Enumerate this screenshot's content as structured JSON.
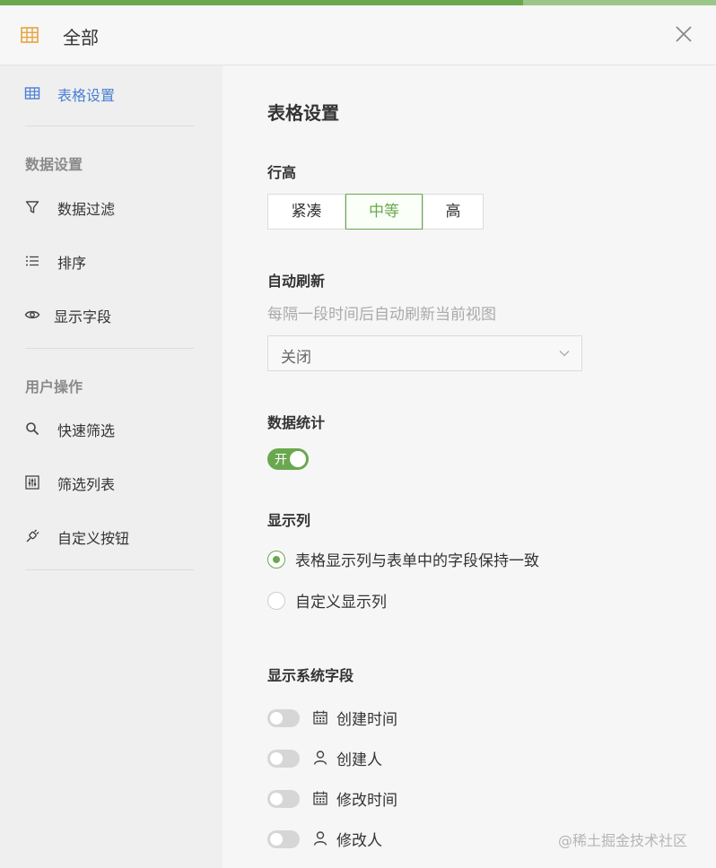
{
  "header": {
    "title": "全部",
    "icon": "table-icon",
    "close_icon": "close-icon"
  },
  "sidebar": {
    "table_settings": "表格设置",
    "group_data": "数据设置",
    "data_filter": "数据过滤",
    "sort": "排序",
    "show_fields": "显示字段",
    "group_user": "用户操作",
    "quick_filter": "快速筛选",
    "filter_list": "筛选列表",
    "custom_button": "自定义按钮"
  },
  "main": {
    "title": "表格设置",
    "row_height": {
      "label": "行高",
      "options": [
        "紧凑",
        "中等",
        "高"
      ],
      "selected": "中等"
    },
    "auto_refresh": {
      "label": "自动刷新",
      "desc": "每隔一段时间后自动刷新当前视图",
      "value": "关闭"
    },
    "data_stats": {
      "label": "数据统计",
      "toggle_text": "开"
    },
    "show_columns": {
      "label": "显示列",
      "options": [
        "表格显示列与表单中的字段保持一致",
        "自定义显示列"
      ],
      "selected": "表格显示列与表单中的字段保持一致"
    },
    "system_fields": {
      "label": "显示系统字段",
      "items": [
        {
          "label": "创建时间",
          "icon": "calendar-icon"
        },
        {
          "label": "创建人",
          "icon": "user-icon"
        },
        {
          "label": "修改时间",
          "icon": "calendar-icon"
        },
        {
          "label": "修改人",
          "icon": "user-icon"
        }
      ]
    }
  },
  "watermark": "@稀土掘金技术社区",
  "colors": {
    "accent": "#6aa84f",
    "link": "#4a7fd4",
    "header_icon": "#e8a33d"
  }
}
